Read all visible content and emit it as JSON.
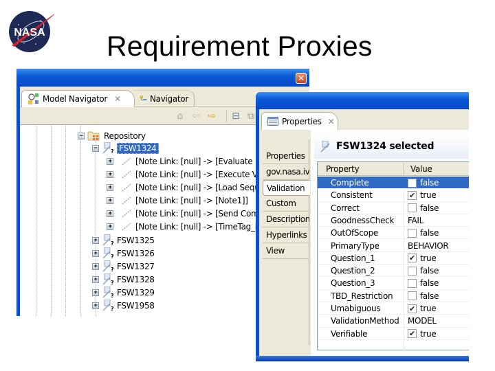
{
  "slide": {
    "title": "Requirement Proxies",
    "logo_text": "NASA"
  },
  "navigator_window": {
    "tabs": [
      {
        "label": "Model Navigator",
        "icon": "model-navigator-icon",
        "active": true
      },
      {
        "label": "Navigator",
        "icon": "navigator-icon",
        "active": false
      }
    ],
    "toolbar_icons": [
      "home-icon",
      "back-arrow-icon",
      "forward-arrow-icon",
      "collapse-all-icon",
      "link-with-editor-icon"
    ],
    "tree": {
      "root": {
        "label": "Repository",
        "expanded": true,
        "icon": "repository-folder-icon"
      },
      "selected_item": {
        "label": "FSW1324",
        "expanded": true
      },
      "note_links": [
        "[Note Link: [null] -> [Evaluate Ne",
        "[Note Link: [null] -> [Execute VM",
        "[Note Link: [null] -> [Load Seque",
        "[Note Link: [null] -> [Note1]]",
        "[Note Link: [null] -> [Send Comm",
        "[Note Link: [null] -> [TimeTag_De"
      ],
      "requirements": [
        "FSW1325",
        "FSW1326",
        "FSW1327",
        "FSW1328",
        "FSW1329",
        "FSW1958"
      ]
    }
  },
  "properties_window": {
    "tab_label": "Properties",
    "side_tabs": [
      "Properties",
      "gov.nasa.iv",
      "Validation",
      "Custom",
      "Description",
      "Hyperlinks",
      "View"
    ],
    "active_side_tab": "Validation",
    "header": "FSW1324 selected",
    "columns": {
      "property": "Property",
      "value": "Value"
    },
    "rows": [
      {
        "name": "Complete",
        "type": "bool",
        "checked": false,
        "value": "false",
        "selected": true
      },
      {
        "name": "Consistent",
        "type": "bool",
        "checked": true,
        "value": "true"
      },
      {
        "name": "Correct",
        "type": "bool",
        "checked": false,
        "value": "false"
      },
      {
        "name": "GoodnessCheck",
        "type": "text",
        "value": "FAIL"
      },
      {
        "name": "OutOfScope",
        "type": "bool",
        "checked": false,
        "value": "false"
      },
      {
        "name": "PrimaryType",
        "type": "text",
        "value": "BEHAVIOR"
      },
      {
        "name": "Question_1",
        "type": "bool",
        "checked": true,
        "value": "true"
      },
      {
        "name": "Question_2",
        "type": "bool",
        "checked": false,
        "value": "false"
      },
      {
        "name": "Question_3",
        "type": "bool",
        "checked": false,
        "value": "false"
      },
      {
        "name": "TBD_Restriction",
        "type": "bool",
        "checked": false,
        "value": "false"
      },
      {
        "name": "Umabiguous",
        "type": "bool",
        "checked": true,
        "value": "true"
      },
      {
        "name": "ValidationMethod",
        "type": "text",
        "value": "MODEL"
      },
      {
        "name": "Verifiable",
        "type": "bool",
        "checked": true,
        "value": "true"
      }
    ]
  },
  "colors": {
    "xp_title_blue": "#0a5ad6",
    "selection_blue": "#316ac5",
    "panel_beige": "#ece9d8",
    "close_red": "#c9401d"
  }
}
